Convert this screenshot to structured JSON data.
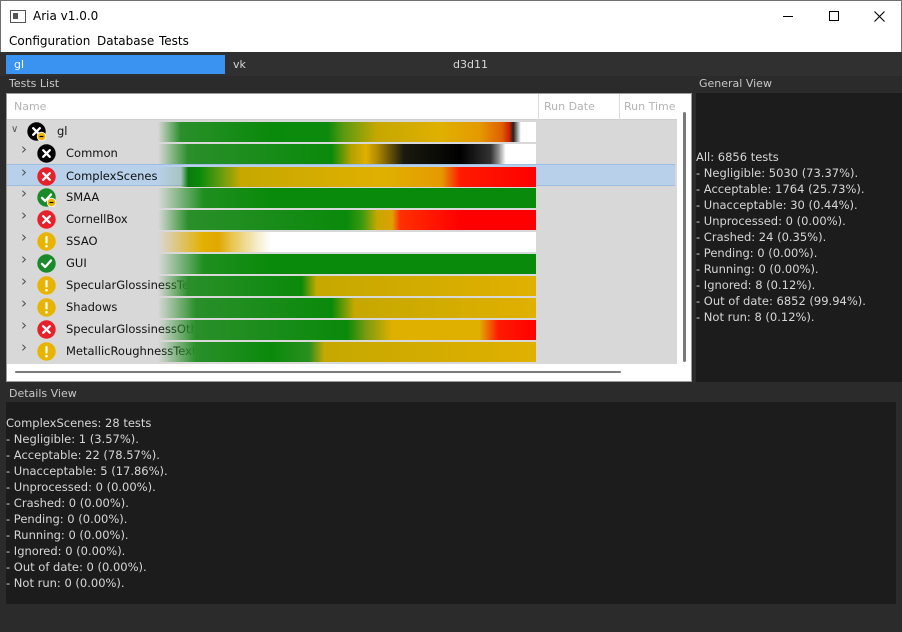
{
  "window": {
    "title": "Aria v1.0.0"
  },
  "menu": {
    "items": [
      "Configuration",
      "Database",
      "Tests"
    ]
  },
  "backend_tabs": [
    "gl",
    "vk",
    "d3d11"
  ],
  "tests_list": {
    "title": "Tests List",
    "columns": [
      "Name",
      "Run Date",
      "Run Time"
    ],
    "rows": [
      {
        "name": "gl",
        "status": "crashed",
        "level": 0,
        "expanded": true,
        "selected": false,
        "bar": "linear-gradient(90deg, rgba(32,140,32,0) 0%, #2a8f2a 6%, #0a8a0a 30%, #0d8a0d 45%, #5a9a10 49%, #c6a800 58%, #e0b000 75%, #e59a00 85%, #e06000 91%, #cc2000 93%, #222 94%, #fff 96%, #fff 100%)"
      },
      {
        "name": "Common",
        "status": "failed-black",
        "level": 1,
        "expanded": false,
        "selected": false,
        "bar": "linear-gradient(90deg, rgba(32,140,32,0) 0%, #2a8f2a 8%, #0a8a0a 46%, #b0a000 51%, #e0b000 55%, #b08a00 58%, #1a1a10 65%, #000 80%, #333 88%, #888 90%, #fff 92%, #fff 100%)"
      },
      {
        "name": "ComplexScenes",
        "status": "failed",
        "level": 1,
        "expanded": false,
        "selected": true,
        "bar": "linear-gradient(90deg, rgba(32,140,32,0) 0%, rgba(100,150,40,0.2) 6%, #0c7a0c 8%, #0a8a0a 11%, #5a9a10 16%, #c6a800 22%, #e0b000 60%, #e59a00 75%, #ff1a00 80%, #ff0000 100%)"
      },
      {
        "name": "SMAA",
        "status": "passed-crashed",
        "level": 1,
        "expanded": false,
        "selected": false,
        "bar": "linear-gradient(90deg, rgba(32,140,32,0) 0%, #1f8f1f 12%, #0a8a0a 30%, #0a8a0a 100%)"
      },
      {
        "name": "CornellBox",
        "status": "failed",
        "level": 1,
        "expanded": false,
        "selected": false,
        "bar": "linear-gradient(90deg, rgba(32,140,32,0) 0%, #2a8f2a 8%, #0a8a0a 50%, #3a9a10 54%, #c6a800 58%, #e0a000 62%, #ff3000 64%, #ff0000 80%, #ff0000 100%)"
      },
      {
        "name": "SSAO",
        "status": "warning",
        "level": 1,
        "expanded": false,
        "selected": false,
        "bar": "linear-gradient(90deg, rgba(230,180,0,0) 0%, #e2b000 12%, #e0a800 16%, #e8c858 20%, #f5ebc8 26%, #ffffff 30%, #ffffff 100%)"
      },
      {
        "name": "GUI",
        "status": "passed",
        "level": 1,
        "expanded": false,
        "selected": false,
        "bar": "linear-gradient(90deg, rgba(32,140,32,0) 0%, #1f8f1f 12%, #0a8a0a 30%, #0a8a0a 100%)"
      },
      {
        "name": "SpecularGlossinessTextures",
        "status": "warning",
        "level": 1,
        "expanded": false,
        "selected": false,
        "bar": "linear-gradient(90deg, rgba(32,140,32,0) 0%, #2a8f2a 8%, #0a8a0a 38%, #c6a800 42%, #e0b000 100%)"
      },
      {
        "name": "Shadows",
        "status": "warning",
        "level": 1,
        "expanded": false,
        "selected": false,
        "bar": "linear-gradient(90deg, rgba(32,140,32,0) 0%, #2a8f2a 10%, #0a8a0a 46%, #c6a800 52%, #e0b000 100%)"
      },
      {
        "name": "SpecularGlossinessOther",
        "status": "failed",
        "level": 1,
        "expanded": false,
        "selected": false,
        "bar": "linear-gradient(90deg, rgba(32,140,32,0) 0%, #2a8f2a 10%, #0a8a0a 50%, #7a9a10 55%, #e0b000 62%, #e0b000 85%, #ff1a00 90%, #ff0000 100%)"
      },
      {
        "name": "MetallicRoughnessTextures",
        "status": "warning",
        "level": 1,
        "expanded": false,
        "selected": false,
        "bar": "linear-gradient(90deg, rgba(32,140,32,0) 0%, #2a8f2a 10%, #0a8a0a 30%, #2a8f20 40%, #c6a800 44%, #e0b000 100%)"
      }
    ]
  },
  "general_view": {
    "title": "General View",
    "lines": [
      "All: 6856 tests",
      "- Negligible: 5030 (73.37%).",
      "- Acceptable: 1764 (25.73%).",
      "- Unacceptable: 30 (0.44%).",
      "- Unprocessed: 0 (0.00%).",
      "- Crashed: 24 (0.35%).",
      "- Pending: 0 (0.00%).",
      "- Running: 0 (0.00%).",
      "- Ignored: 8 (0.12%).",
      "- Out of date: 6852 (99.94%).",
      "- Not run: 8 (0.12%)."
    ]
  },
  "details_view": {
    "title": "Details View",
    "lines": [
      "ComplexScenes: 28 tests",
      "- Negligible: 1 (3.57%).",
      "- Acceptable: 22 (78.57%).",
      "- Unacceptable: 5 (17.86%).",
      "- Unprocessed: 0 (0.00%).",
      "- Crashed: 0 (0.00%).",
      "- Pending: 0 (0.00%).",
      "- Running: 0 (0.00%).",
      "- Ignored: 0 (0.00%).",
      "- Out of date: 0 (0.00%).",
      "- Not run: 0 (0.00%)."
    ]
  },
  "icons": {
    "minimize": "minimize-icon",
    "maximize": "maximize-icon",
    "close": "close-icon",
    "expand": "chevron-right-icon",
    "collapse": "chevron-down-icon"
  },
  "colors": {
    "accent_tab": "#3a93f0",
    "passed": "#0a8a0a",
    "acceptable": "#e0b000",
    "failed": "#ff0000",
    "crashed": "#000000",
    "selected_row": "#b8d0ea"
  }
}
